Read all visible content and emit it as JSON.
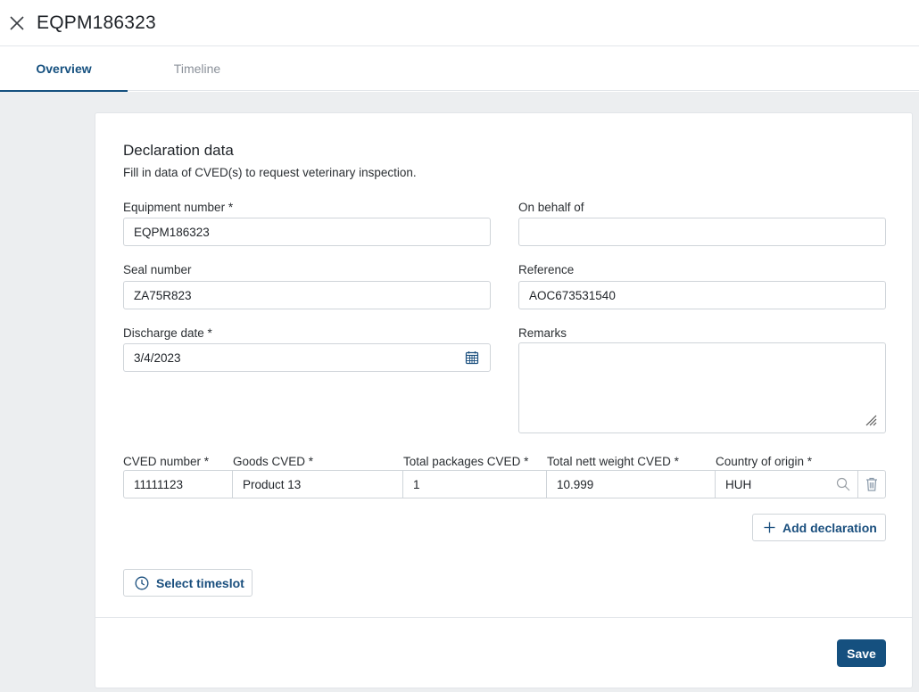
{
  "header": {
    "title": "EQPM186323",
    "close_icon": "close-icon"
  },
  "tabs": [
    {
      "label": "Overview",
      "active": true
    },
    {
      "label": "Timeline",
      "active": false
    }
  ],
  "form": {
    "title": "Declaration data",
    "subtitle": "Fill in data of CVED(s) to request veterinary inspection.",
    "equipment_number": {
      "label": "Equipment number *",
      "value": "EQPM186323"
    },
    "on_behalf_of": {
      "label": "On behalf of",
      "value": ""
    },
    "seal_number": {
      "label": "Seal number",
      "value": "ZA75R823"
    },
    "reference": {
      "label": "Reference",
      "value": "AOC673531540"
    },
    "discharge_date": {
      "label": "Discharge date *",
      "value": "3/4/2023",
      "icon": "calendar-icon"
    },
    "remarks": {
      "label": "Remarks",
      "value": ""
    }
  },
  "declarations": {
    "columns": [
      "CVED number *",
      "Goods CVED *",
      "Total packages CVED *",
      "Total nett weight CVED *",
      "Country of origin *"
    ],
    "rows": [
      {
        "cved_number": "11111123",
        "goods": "Product 13",
        "packages": "1",
        "weight": "10.999",
        "country": "HUH"
      }
    ],
    "add_label": "Add declaration"
  },
  "timeslot_label": "Select timeslot",
  "save_label": "Save",
  "colors": {
    "primary": "#15507f",
    "background": "#eceef0",
    "border": "#cfd4d9"
  }
}
